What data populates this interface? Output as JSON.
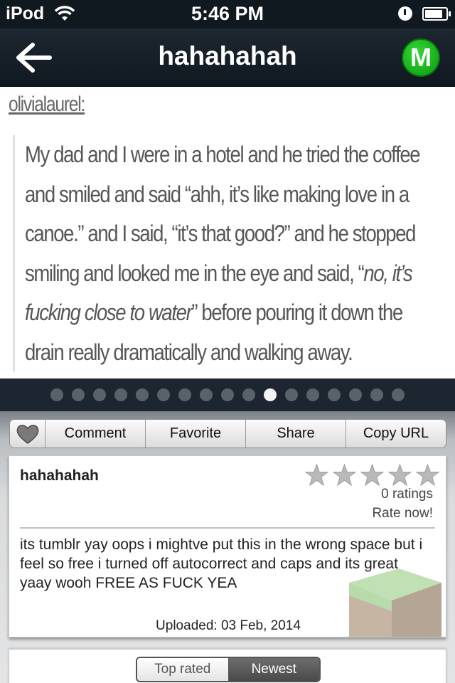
{
  "status_bar": {
    "carrier": "iPod",
    "time": "5:46 PM"
  },
  "nav": {
    "title": "hahahahah",
    "logo_letter": "M"
  },
  "post": {
    "username": "olivialaurel:",
    "quote_part1": "My dad and I were in a hotel and he tried the coffee and smiled and said “ahh, it’s like making love in a canoe.” and I said, “it’s that good?” and he stopped smiling and looked me in the eye and said, “",
    "quote_italic": "no, it’s fucking close to water",
    "quote_part2": "” before pouring it down the drain really dramatically and walking away."
  },
  "pager": {
    "total": 17,
    "active_index": 10
  },
  "actions": {
    "comment": "Comment",
    "favorite": "Favorite",
    "share": "Share",
    "copy_url": "Copy URL"
  },
  "details": {
    "title": "hahahahah",
    "ratings": "0 ratings",
    "rate_now": "Rate now!",
    "description": "its tumblr yay oops i mightve put this in the wrong space but i feel so free i turned off autocorrect and caps and its great yaay wooh FREE AS FUCK YEA",
    "uploaded": "Uploaded: 03 Feb, 2014",
    "star_count": 5,
    "rating_value": 0
  },
  "sort": {
    "top_rated": "Top rated",
    "newest": "Newest",
    "selected": "Newest"
  },
  "colors": {
    "nav_background": "#101820",
    "logo_green": "#19b51f",
    "active_segment": "#555555"
  },
  "icons": {
    "wifi": "wifi-icon",
    "lock": "rotation-lock-icon",
    "battery": "battery-icon",
    "back": "back-arrow-icon",
    "heart": "heart-icon",
    "star": "star-icon"
  }
}
